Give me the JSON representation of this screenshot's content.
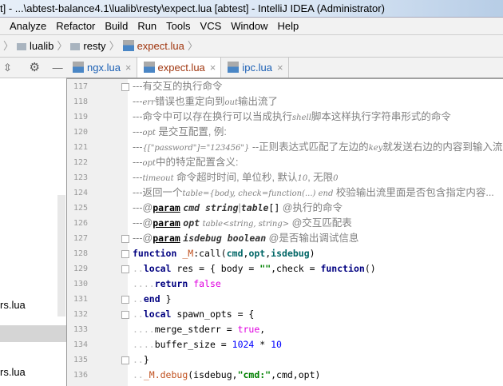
{
  "window": {
    "title": "t] - ...\\abtest-balance4.1\\lualib\\resty\\expect.lua [abtest] - IntelliJ IDEA (Administrator)"
  },
  "menu": [
    "Analyze",
    "Refactor",
    "Build",
    "Run",
    "Tools",
    "VCS",
    "Window",
    "Help"
  ],
  "breadcrumb": [
    "lualib",
    "resty",
    "expect.lua"
  ],
  "tabs": [
    {
      "label": "ngx.lua",
      "active": false
    },
    {
      "label": "expect.lua",
      "active": true
    },
    {
      "label": "ipc.lua",
      "active": false
    }
  ],
  "sidebar": {
    "files": [
      "rs.lua",
      "rs.lua"
    ]
  },
  "colors": {
    "keyword": "#000080",
    "string": "#008000",
    "number": "#0000ff",
    "comment": "#808080",
    "boolean": "#e000e0"
  },
  "code": [
    {
      "n": "117",
      "t": [
        [
          "c",
          "---有交互的执行命令"
        ]
      ]
    },
    {
      "n": "118",
      "t": [
        [
          "c",
          "---"
        ],
        [
          "ci",
          "err"
        ],
        [
          "c",
          "错误也重定向到"
        ],
        [
          "ci",
          "out"
        ],
        [
          "c",
          "输出流了"
        ]
      ]
    },
    {
      "n": "119",
      "t": [
        [
          "c",
          "---命令中可以存在换行可以当成执行"
        ],
        [
          "ci",
          "shell"
        ],
        [
          "c",
          "脚本这样执行字符串形式的命令"
        ]
      ]
    },
    {
      "n": "120",
      "t": [
        [
          "c",
          "---"
        ],
        [
          "ci",
          "opt"
        ],
        [
          "c",
          " 是交互配置, 例:"
        ]
      ]
    },
    {
      "n": "121",
      "t": [
        [
          "c",
          "---"
        ],
        [
          "ci",
          "{[\"password\"]=\"123456\"}"
        ],
        [
          "c",
          " --正则表达式匹配了左边的"
        ],
        [
          "ci",
          "key"
        ],
        [
          "c",
          "就发送右边的内容到输入流"
        ]
      ]
    },
    {
      "n": "122",
      "t": [
        [
          "c",
          "---"
        ],
        [
          "ci",
          "opt"
        ],
        [
          "c",
          "中的特定配置含义:"
        ]
      ]
    },
    {
      "n": "123",
      "t": [
        [
          "c",
          "---"
        ],
        [
          "ci",
          "timeout"
        ],
        [
          "c",
          " 命令超时时间, 单位秒, 默认"
        ],
        [
          "ci",
          "10"
        ],
        [
          "c",
          ", 无限"
        ],
        [
          "ci",
          "0"
        ]
      ]
    },
    {
      "n": "124",
      "t": [
        [
          "c",
          "---返回一个"
        ],
        [
          "ci",
          "table={body, check=function(...) end"
        ],
        [
          "c",
          " 校验输出流里面是否包含指定内容..."
        ]
      ]
    },
    {
      "n": "125",
      "t": [
        [
          "c",
          "---@"
        ],
        [
          "ct",
          "param"
        ],
        [
          "c",
          " "
        ],
        [
          "cp",
          "cmd string"
        ],
        [
          "c",
          "|"
        ],
        [
          "cp",
          "table"
        ],
        [
          "n",
          "[]"
        ],
        [
          "c",
          " @执行的命令"
        ]
      ]
    },
    {
      "n": "126",
      "t": [
        [
          "c",
          "---@"
        ],
        [
          "ct",
          "param"
        ],
        [
          "c",
          " "
        ],
        [
          "cp",
          "opt"
        ],
        [
          "c",
          " "
        ],
        [
          "ci",
          "table<string, string>"
        ],
        [
          "c",
          " @交互匹配表"
        ]
      ]
    },
    {
      "n": "127",
      "t": [
        [
          "c",
          "---@"
        ],
        [
          "ct",
          "param"
        ],
        [
          "c",
          " "
        ],
        [
          "cp",
          "isdebug boolean"
        ],
        [
          "c",
          " @是否输出调试信息"
        ]
      ]
    },
    {
      "n": "128",
      "t": [
        [
          "k",
          "function"
        ],
        [
          "n",
          " "
        ],
        [
          "fn",
          "_M"
        ],
        [
          "n",
          ":call("
        ],
        [
          "p",
          "cmd"
        ],
        [
          "n",
          ","
        ],
        [
          "p",
          "opt"
        ],
        [
          "n",
          ","
        ],
        [
          "p",
          "isdebug"
        ],
        [
          "n",
          ")"
        ]
      ]
    },
    {
      "n": "129",
      "t": [
        [
          "d",
          ".."
        ],
        [
          "k",
          "local"
        ],
        [
          "n",
          " res = { body = "
        ],
        [
          "s",
          "\"\""
        ],
        [
          "n",
          ",check = "
        ],
        [
          "k",
          "function"
        ],
        [
          "n",
          "()"
        ]
      ]
    },
    {
      "n": "130",
      "t": [
        [
          "d",
          "...."
        ],
        [
          "k",
          "return"
        ],
        [
          "n",
          " "
        ],
        [
          "b",
          "false"
        ]
      ]
    },
    {
      "n": "131",
      "t": [
        [
          "d",
          ".."
        ],
        [
          "k",
          "end"
        ],
        [
          "n",
          " }"
        ]
      ]
    },
    {
      "n": "132",
      "t": [
        [
          "d",
          ".."
        ],
        [
          "k",
          "local"
        ],
        [
          "n",
          " spawn_opts = {"
        ]
      ]
    },
    {
      "n": "133",
      "t": [
        [
          "d",
          "...."
        ],
        [
          "n",
          "merge_stderr = "
        ],
        [
          "b",
          "true"
        ],
        [
          "n",
          ","
        ]
      ]
    },
    {
      "n": "134",
      "t": [
        [
          "d",
          "...."
        ],
        [
          "n",
          "buffer_size = "
        ],
        [
          "num",
          "1024"
        ],
        [
          "n",
          " * "
        ],
        [
          "num",
          "10"
        ]
      ]
    },
    {
      "n": "135",
      "t": [
        [
          "d",
          ".."
        ],
        [
          "n",
          "}"
        ]
      ]
    },
    {
      "n": "136",
      "t": [
        [
          "d",
          ".."
        ],
        [
          "fn",
          "_M.debug"
        ],
        [
          "n",
          "(isdebug,"
        ],
        [
          "s",
          "\"cmd:\""
        ],
        [
          "n",
          ",cmd,opt)"
        ]
      ]
    }
  ]
}
